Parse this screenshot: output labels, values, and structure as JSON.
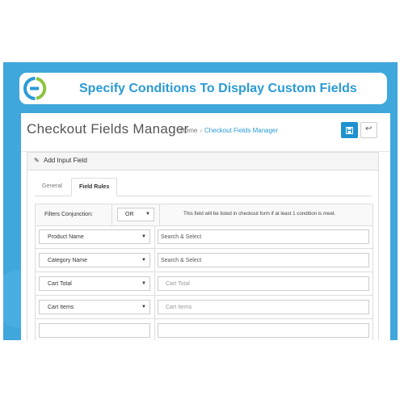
{
  "banner": {
    "title": "Specify Conditions To Display Custom Fields"
  },
  "page": {
    "title": "Checkout Fields Manager",
    "breadcrumb": {
      "home": "Home",
      "separator": "›",
      "current": "Checkout Fields Manager"
    }
  },
  "card": {
    "title": "Add Input Field"
  },
  "tabs": {
    "general": "General",
    "field_rules": "Field Rules"
  },
  "conjunction": {
    "label": "Filters Conjunction:",
    "value": "OR",
    "note": "This field will be listed in checkout form if at least 1 condition is meet."
  },
  "rules": [
    {
      "select": "Product Name",
      "placeholder": "Search & Select"
    },
    {
      "select": "Category Name",
      "placeholder": "Search & Select"
    },
    {
      "select": "Cart Total",
      "placeholder": "Cart Total"
    },
    {
      "select": "Cart Items",
      "placeholder": "Cart Items"
    }
  ],
  "colors": {
    "banner_bg": "#3fa7db",
    "accent": "#2a9bd6",
    "primary_button": "#1e91cf"
  },
  "icons": {
    "logo": "brand-logo-icon",
    "pencil": "pencil-icon",
    "save": "save-icon",
    "back": "reply-icon",
    "caret": "caret-down-icon"
  }
}
